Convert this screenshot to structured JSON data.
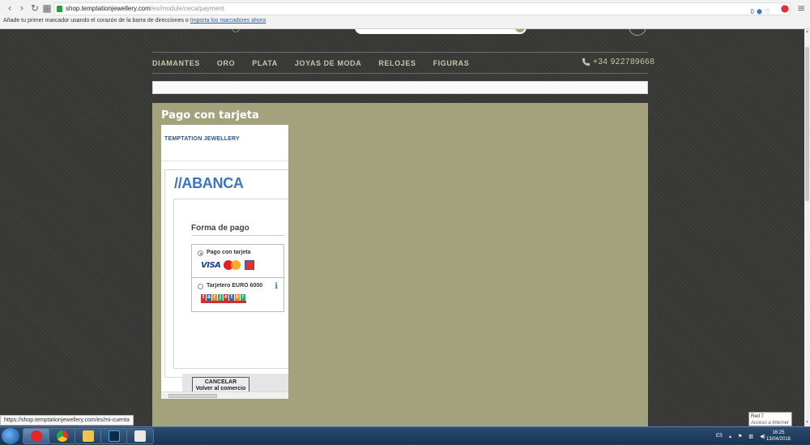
{
  "browser": {
    "address_host": "shop.temptationjewellery.com",
    "address_path": "/es/module/ceca/payment",
    "bookmarks_text": "Añade tu primer marcador usando el corazón de la barra de direcciones o",
    "bookmarks_link": "Importa los marcadores ahora",
    "ext_badge": "0"
  },
  "nav": {
    "items": [
      "DIAMANTES",
      "ORO",
      "PLATA",
      "JOYAS DE MODA",
      "RELOJES",
      "FIGURAS"
    ],
    "phone": "+34 922789668"
  },
  "panel": {
    "title": "Pago con tarjeta"
  },
  "payment": {
    "merchant": "TEMPTATION JEWELLERY",
    "bank_logo": "//ABANCA",
    "section_title": "Forma de pago",
    "option1_label": "Pago con tarjeta",
    "option1_cards": [
      "VISA"
    ],
    "option2_label": "Tarjetero EURO 6000",
    "option2_logo": "tarjetero",
    "cancel_line1": "CANCELAR",
    "cancel_line2": "Volver al comercio"
  },
  "status": {
    "url": "https://shop.temptationjewellery.com/es/mi-cuenta"
  },
  "taskbar": {
    "lang": "ES",
    "time": "16:25",
    "date": "13/04/2018",
    "net_tip_title": "Red 7",
    "net_tip_sub": "Acceso a Internet"
  },
  "colors": {
    "panel": "#a3a27c",
    "nav_text": "#c9c8a4",
    "bank_blue": "#3a74c4"
  }
}
